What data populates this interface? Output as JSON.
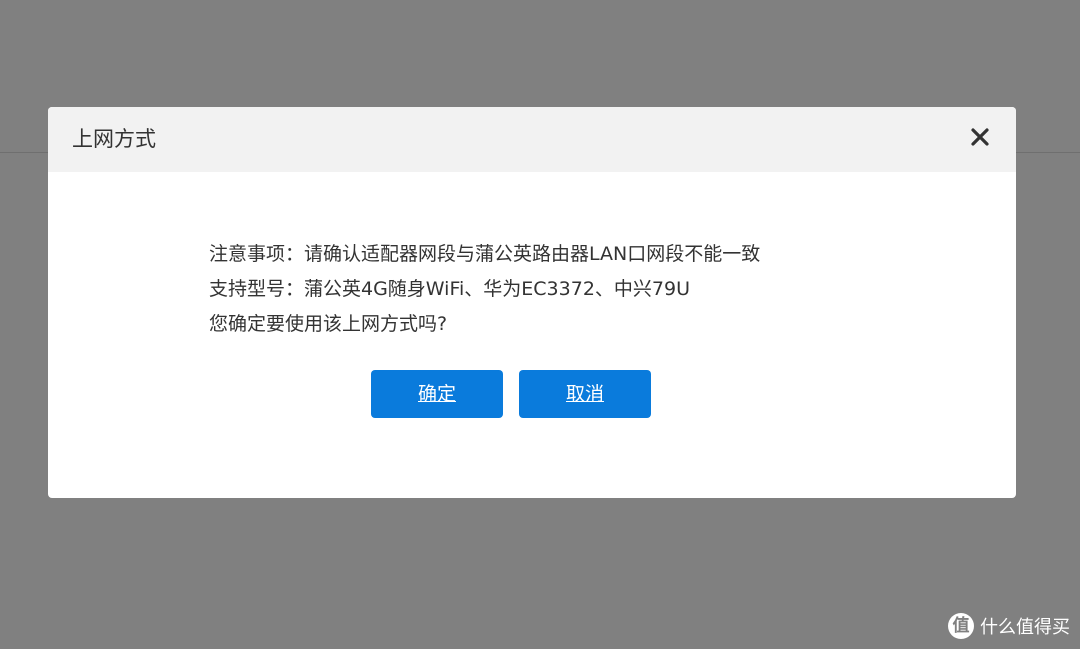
{
  "dialog": {
    "title": "上网方式",
    "close_icon": "close-icon",
    "message_lines": [
      "注意事项：请确认适配器网段与蒲公英路由器LAN口网段不能一致",
      "支持型号：蒲公英4G随身WiFi、华为EC3372、中兴79U",
      "您确定要使用该上网方式吗?"
    ],
    "confirm_label": "确定",
    "cancel_label": "取消"
  },
  "watermark": {
    "logo_glyph": "值",
    "text": "什么值得买"
  },
  "colors": {
    "overlay": "#808080",
    "header_bg": "#f2f2f2",
    "primary_button": "#0a7bdc"
  }
}
